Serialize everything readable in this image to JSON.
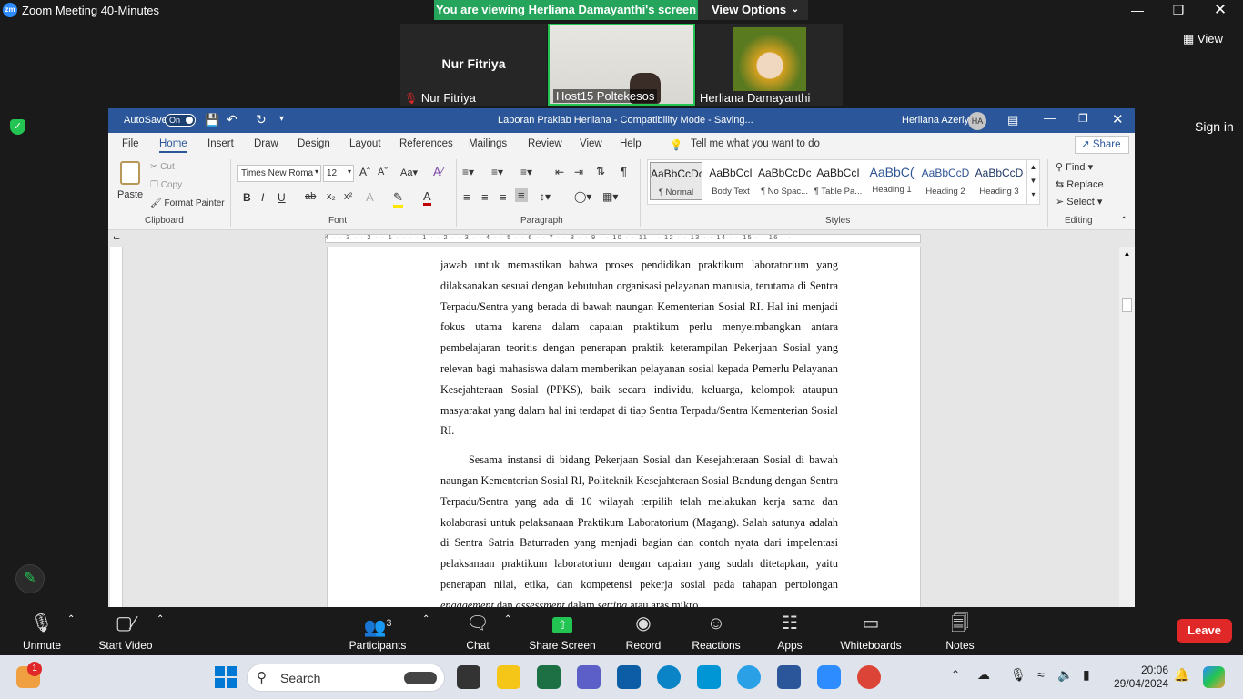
{
  "zoom": {
    "window_title": "Zoom Meeting 40-Minutes",
    "logo_text": "zm",
    "share_banner": "You are viewing Herliana Damayanthi's screen",
    "view_options": "View Options",
    "view_label": "View",
    "sign_in": "Sign in",
    "participants": [
      {
        "name": "Nur Fitriya",
        "display_name": "Nur Fitriya",
        "muted": true
      },
      {
        "name": "Host15 Poltekesos",
        "video": true
      },
      {
        "name": "Herliana Damayanthi",
        "video": true
      }
    ],
    "toolbar": {
      "unmute": "Unmute",
      "start_video": "Start Video",
      "participants": "Participants",
      "participants_count": "3",
      "chat": "Chat",
      "share_screen": "Share Screen",
      "record": "Record",
      "reactions": "Reactions",
      "apps": "Apps",
      "whiteboards": "Whiteboards",
      "notes": "Notes",
      "leave": "Leave"
    }
  },
  "word": {
    "autosave_label": "AutoSave",
    "autosave_state": "On",
    "doc_title": "Laporan Praklab Herliana  -  Compatibility Mode  -  Saving...",
    "user_name": "Herliana Azerly",
    "user_initials": "HA",
    "tabs": [
      "File",
      "Home",
      "Insert",
      "Draw",
      "Design",
      "Layout",
      "References",
      "Mailings",
      "Review",
      "View",
      "Help"
    ],
    "tell_me": "Tell me what you want to do",
    "share": "Share",
    "clipboard": {
      "paste": "Paste",
      "cut": "Cut",
      "copy": "Copy",
      "format_painter": "Format Painter",
      "label": "Clipboard"
    },
    "font": {
      "name": "Times New Roma",
      "size": "12",
      "label": "Font"
    },
    "paragraph_label": "Paragraph",
    "styles_label": "Styles",
    "styles": [
      {
        "preview": "AaBbCcDc",
        "name": "¶ Normal"
      },
      {
        "preview": "AaBbCcI",
        "name": "Body Text"
      },
      {
        "preview": "AaBbCcDc",
        "name": "¶ No Spac..."
      },
      {
        "preview": "AaBbCcI",
        "name": "¶ Table Pa..."
      },
      {
        "preview": "AaBbC(",
        "name": "Heading 1"
      },
      {
        "preview": "AaBbCcD",
        "name": "Heading 2"
      },
      {
        "preview": "AaBbCcD",
        "name": "Heading 3"
      }
    ],
    "editing": {
      "find": "Find",
      "replace": "Replace",
      "select": "Select",
      "label": "Editing"
    },
    "ruler_ticks": "4 · · 3 · · 2 · · 1 · ·   · · 1 · · 2 · · 3 · · 4 · · 5 · · 6 · · 7 · · 8 · · 9 · · 10 · · 11 · · 12 · · 13 · · 14 · · 15 · · 16 · ·",
    "paragraph_1": "jawab untuk memastikan bahwa proses pendidikan praktikum laboratorium yang dilaksanakan sesuai dengan kebutuhan organisasi pelayanan manusia, terutama di Sentra Terpadu/Sentra yang berada di bawah naungan Kementerian Sosial RI. Hal ini menjadi fokus utama karena dalam capaian praktikum perlu menyeimbangkan antara pembelajaran teoritis dengan penerapan praktik keterampilan Pekerjaan Sosial yang relevan bagi mahasiswa dalam memberikan pelayanan sosial kepada Pemerlu Pelayanan Kesejahteraan Sosial (PPKS), baik secara individu, keluarga, kelompok ataupun masyarakat yang dalam hal ini terdapat di tiap Sentra Terpadu/Sentra Kementerian Sosial RI.",
    "paragraph_2": "Sesama instansi di bidang Pekerjaan Sosial dan Kesejahteraan Sosial di bawah naungan Kementerian Sosial RI, Politeknik Kesejahteraan Sosial Bandung dengan Sentra Terpadu/Sentra yang ada di 10 wilayah terpilih telah melakukan kerja sama dan kolaborasi untuk pelaksanaan Praktikum Laboratorium (Magang). Salah satunya adalah di Sentra Satria Baturraden yang menjadi bagian dan contoh nyata dari impelentasi pelaksanaan praktikum laboratorium dengan capaian yang sudah ditetapkan, yaitu penerapan nilai, etika, dan kompetensi pekerja sosial pada",
    "paragraph_2_tail_a": "tahapan pertolongan ",
    "paragraph_2_tail_b": "engagement",
    "paragraph_2_tail_c": " dan ",
    "paragraph_2_tail_d": "assessment",
    "paragraph_2_tail_e": " dalam ",
    "paragraph_2_tail_f": "setting",
    "paragraph_2_tail_g": " atau aras mikro."
  },
  "taskbar": {
    "search_placeholder": "Search",
    "notification_badge": "1",
    "time": "20:06",
    "date": "29/04/2024"
  },
  "colors": {
    "zoom_green": "#25a55b",
    "word_blue": "#2b579a",
    "leave_red": "#e02828"
  }
}
